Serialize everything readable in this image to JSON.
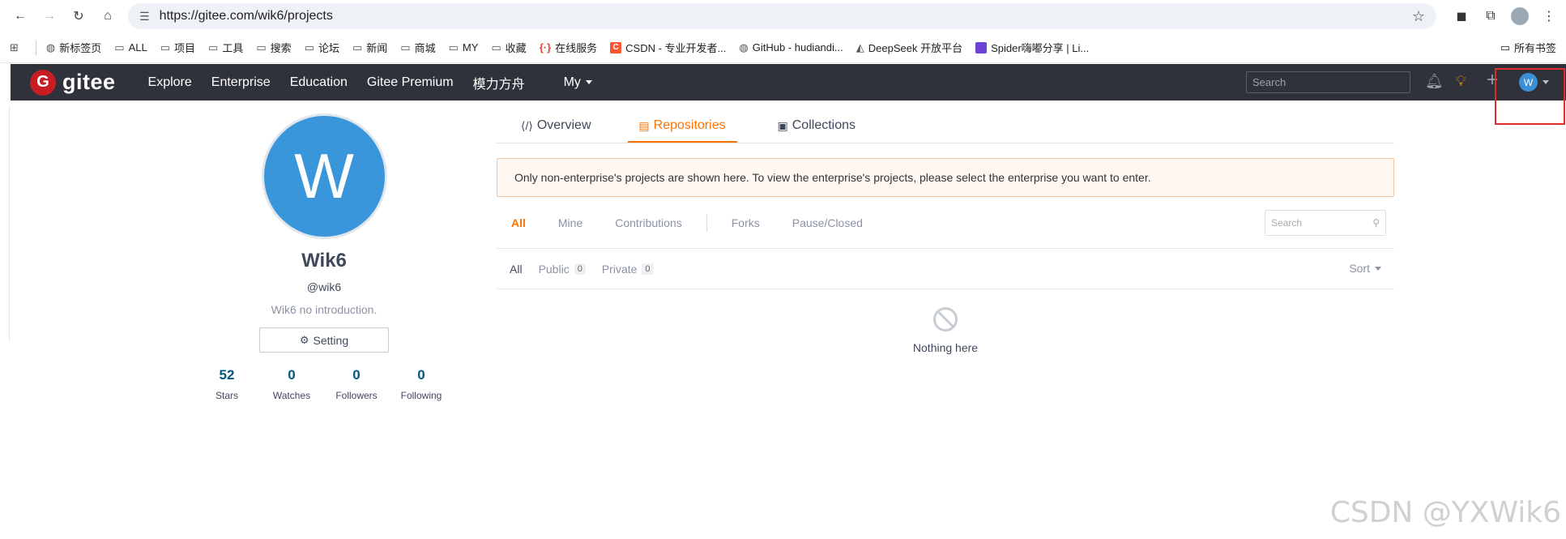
{
  "browser": {
    "url": "https://gitee.com/wik6/projects",
    "bookmarks": [
      {
        "icon": "grid",
        "label": ""
      },
      {
        "icon": "globe",
        "label": "新标签页"
      },
      {
        "icon": "folder",
        "label": "ALL"
      },
      {
        "icon": "folder",
        "label": "项目"
      },
      {
        "icon": "folder",
        "label": "工具"
      },
      {
        "icon": "folder",
        "label": "搜索"
      },
      {
        "icon": "folder",
        "label": "论坛"
      },
      {
        "icon": "folder",
        "label": "新闻"
      },
      {
        "icon": "folder",
        "label": "商城"
      },
      {
        "icon": "folder",
        "label": "MY"
      },
      {
        "icon": "folder",
        "label": "收藏"
      },
      {
        "icon": "service",
        "label": "在线服务"
      },
      {
        "icon": "csdn",
        "label": "CSDN - 专业开发者..."
      },
      {
        "icon": "github",
        "label": "GitHub - hudiandi..."
      },
      {
        "icon": "deepseek",
        "label": "DeepSeek 开放平台"
      },
      {
        "icon": "spider",
        "label": "Spider嗨嘟分享 | Li..."
      }
    ],
    "all_bookmarks": "所有书签"
  },
  "gitee_nav": {
    "logo_text": "gitee",
    "links": [
      "Explore",
      "Enterprise",
      "Education",
      "Gitee Premium",
      "模力方舟"
    ],
    "my": "My",
    "search_placeholder": "Search",
    "avatar_letter": "W"
  },
  "profile": {
    "avatar_letter": "W",
    "name": "Wik6",
    "handle": "@wik6",
    "intro": "Wik6 no introduction.",
    "setting": "Setting",
    "stats": [
      {
        "num": "52",
        "label": "Stars"
      },
      {
        "num": "0",
        "label": "Watches"
      },
      {
        "num": "0",
        "label": "Followers"
      },
      {
        "num": "0",
        "label": "Following"
      }
    ]
  },
  "main": {
    "tabs": [
      "Overview",
      "Repositories",
      "Collections"
    ],
    "notice": "Only non-enterprise's projects are shown here. To view the enterprise's projects, please select the enterprise you want to enter.",
    "filters": [
      "All",
      "Mine",
      "Contributions",
      "Forks",
      "Pause/Closed"
    ],
    "search_placeholder": "Search",
    "types": [
      {
        "label": "All",
        "count": ""
      },
      {
        "label": "Public",
        "count": "0"
      },
      {
        "label": "Private",
        "count": "0"
      }
    ],
    "sort": "Sort",
    "empty_text": "Nothing here"
  },
  "watermark": "CSDN @YXWik6",
  "colors": {
    "accent": "#fe7300",
    "nav_bg": "#2f323a",
    "avatar": "#3a96db",
    "highlight": "#e32b2b"
  }
}
